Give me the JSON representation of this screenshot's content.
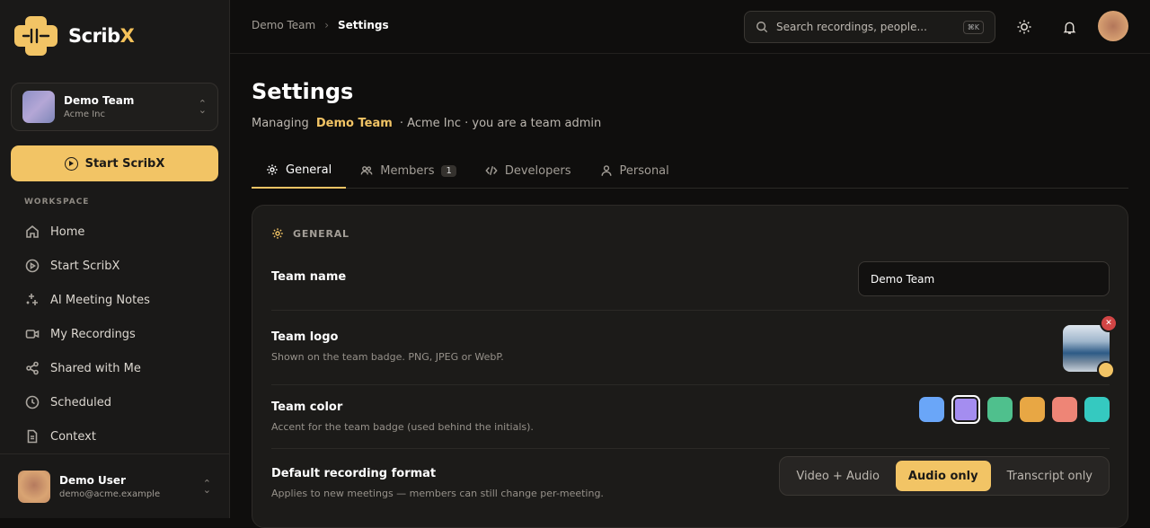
{
  "app": {
    "name_main": "Scrib",
    "name_accent": "X"
  },
  "team_switcher": {
    "name": "Demo Team",
    "org": "Acme Inc"
  },
  "start_button": {
    "label": "Start ScribX"
  },
  "workspace_label": "WORKSPACE",
  "nav": [
    {
      "label": "Home",
      "icon": "home-icon"
    },
    {
      "label": "Start ScribX",
      "icon": "play-circle-icon"
    },
    {
      "label": "AI Meeting Notes",
      "icon": "sparkles-icon"
    },
    {
      "label": "My Recordings",
      "icon": "video-icon"
    },
    {
      "label": "Shared with Me",
      "icon": "share-icon"
    },
    {
      "label": "Scheduled",
      "icon": "clock-icon"
    },
    {
      "label": "Context",
      "icon": "document-icon"
    }
  ],
  "user": {
    "name": "Demo User",
    "email": "demo@acme.example"
  },
  "breadcrumb": {
    "parent": "Demo Team",
    "current": "Settings"
  },
  "search": {
    "placeholder": "Search recordings, people...",
    "shortcut": "⌘K"
  },
  "page": {
    "title": "Settings",
    "subtitle_prefix": "Managing",
    "subtitle_team": "Demo Team",
    "subtitle_suffix": "· Acme Inc · you are a team admin"
  },
  "tabs": [
    {
      "label": "General",
      "icon": "gear-icon",
      "active": true
    },
    {
      "label": "Members",
      "icon": "users-icon",
      "badge": "1"
    },
    {
      "label": "Developers",
      "icon": "code-icon"
    },
    {
      "label": "Personal",
      "icon": "user-icon"
    }
  ],
  "general": {
    "section_title": "GENERAL",
    "team_name": {
      "label": "Team name",
      "value": "Demo Team"
    },
    "team_logo": {
      "label": "Team logo",
      "desc": "Shown on the team badge. PNG, JPEG or WebP."
    },
    "team_color": {
      "label": "Team color",
      "desc": "Accent for the team badge (used behind the initials).",
      "options": [
        "#6aa6f8",
        "#a48df0",
        "#4fc08d",
        "#e8a744",
        "#ee8576",
        "#35c9c0"
      ],
      "selected_index": 1
    },
    "recording_format": {
      "label": "Default recording format",
      "desc": "Applies to new meetings — members can still change per-meeting.",
      "options": [
        "Video + Audio",
        "Audio only",
        "Transcript only"
      ],
      "selected": "Audio only"
    }
  },
  "colors": {
    "accent": "#f2c465",
    "danger": "#d24545"
  }
}
